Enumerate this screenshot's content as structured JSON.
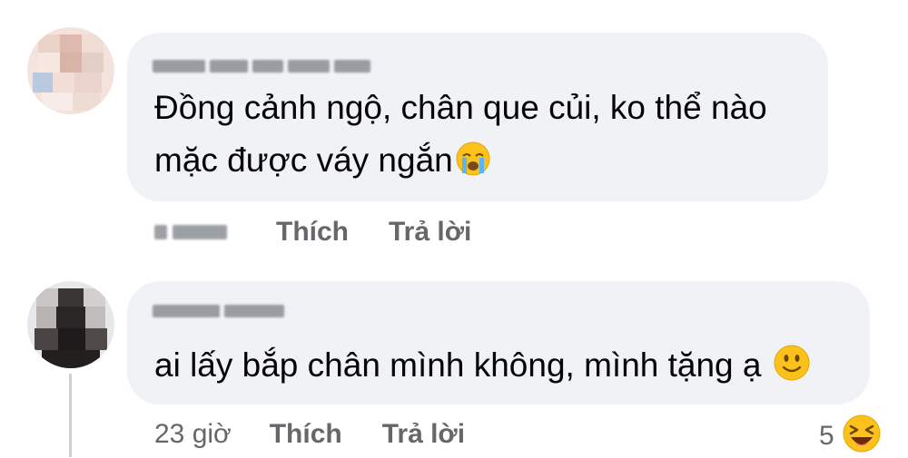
{
  "comments": [
    {
      "text_line1": "Đồng cảnh ngộ, chân que củi, ko thể nào",
      "text_line2": "mặc được váy ngắn",
      "emoji": "crying-face-icon",
      "actions": {
        "like": "Thích",
        "reply": "Trả lời"
      }
    },
    {
      "text_line1": "ai lấy bắp chân mình không, mình tặng ạ",
      "emoji": "slightly-smiling-face-icon",
      "time": "23 giờ",
      "actions": {
        "like": "Thích",
        "reply": "Trả lời"
      },
      "reactions": {
        "count": "5",
        "icon": "laughing-face-icon"
      }
    }
  ],
  "colors": {
    "bubble": "#f0f2f5",
    "meta_text": "#65676b",
    "text": "#050505"
  }
}
